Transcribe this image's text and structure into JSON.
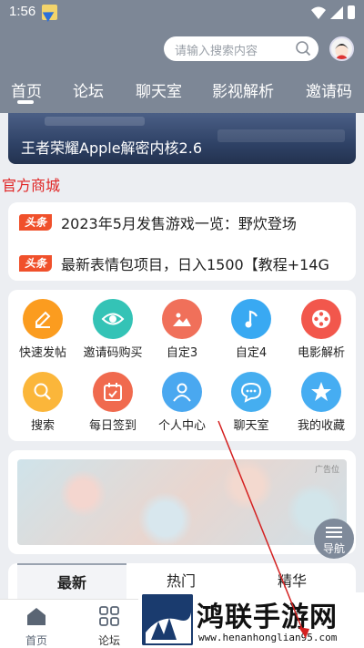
{
  "status": {
    "time": "1:56"
  },
  "search": {
    "placeholder": "请输入搜索内容"
  },
  "tabs": [
    "首页",
    "论坛",
    "聊天室",
    "影视解析",
    "邀请码"
  ],
  "banner": {
    "caption": "王者荣耀Apple解密内核2.6"
  },
  "section_title": "官方商城",
  "news": {
    "tag": "头条",
    "items": [
      "2023年5月发售游戏一览：野炊登场",
      "最新表情包项目，日入1500【教程+14G"
    ]
  },
  "grid": [
    {
      "label": "快速发帖",
      "color": "#fb9c1f",
      "icon": "edit-icon"
    },
    {
      "label": "邀请码购买",
      "color": "#34c3b6",
      "icon": "eye-icon"
    },
    {
      "label": "自定3",
      "color": "#f0705a",
      "icon": "image-icon"
    },
    {
      "label": "自定4",
      "color": "#39a9f2",
      "icon": "music-icon"
    },
    {
      "label": "电影解析",
      "color": "#f2574c",
      "icon": "film-reel-icon"
    },
    {
      "label": "搜索",
      "color": "#fbb63a",
      "icon": "search-icon"
    },
    {
      "label": "每日签到",
      "color": "#f06a4e",
      "icon": "calendar-check-icon"
    },
    {
      "label": "个人中心",
      "color": "#4aa8f0",
      "icon": "user-icon"
    },
    {
      "label": "聊天室",
      "color": "#45aef0",
      "icon": "chat-icon"
    },
    {
      "label": "我的收藏",
      "color": "#46adf2",
      "icon": "star-icon"
    }
  ],
  "ad": {
    "label": "广告位"
  },
  "fab": {
    "label": "导航"
  },
  "bottom_tabs": [
    "最新",
    "热门",
    "精华"
  ],
  "bottom_nav": [
    {
      "label": "首页",
      "icon": "home-icon"
    },
    {
      "label": "论坛",
      "icon": "grid-icon"
    }
  ],
  "watermark": {
    "title": "鸿联手游网",
    "url": "www.henanhonglian95.com"
  },
  "colors": {
    "header": "#7d8796",
    "accent_red": "#e02424",
    "news_tag": "#f0502b",
    "arrow": "#d42020"
  }
}
